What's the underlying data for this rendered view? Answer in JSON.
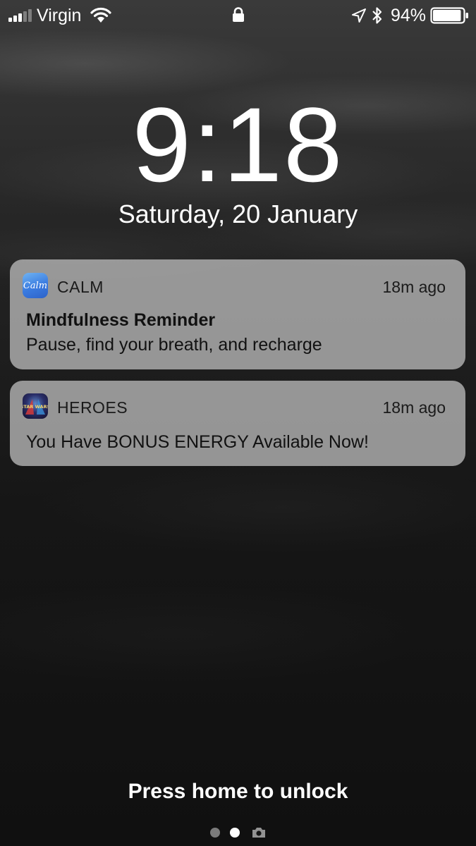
{
  "status_bar": {
    "carrier": "Virgin",
    "battery_percent": "94%",
    "signal_bars_filled": 3,
    "signal_bars_total": 5,
    "battery_level": 0.94,
    "icons": [
      "signal-icon",
      "wifi-icon",
      "lock-icon",
      "location-icon",
      "bluetooth-icon",
      "battery-icon"
    ]
  },
  "lock_screen": {
    "time": "9:18",
    "date": "Saturday, 20 January",
    "unlock_hint": "Press home to unlock"
  },
  "notifications": [
    {
      "app": "CALM",
      "icon": "calm-app-icon",
      "icon_text": "Calm",
      "time": "18m ago",
      "title": "Mindfulness Reminder",
      "body": "Pause, find your breath, and recharge"
    },
    {
      "app": "HEROES",
      "icon": "star-wars-heroes-app-icon",
      "icon_text": "STAR WARS",
      "time": "18m ago",
      "title": "",
      "body": "You Have BONUS ENERGY Available Now!"
    }
  ],
  "page_indicator": {
    "pages": 2,
    "active_index": 1,
    "trailing_icon": "camera-icon"
  },
  "colors": {
    "notification_background": "#b9b9b9",
    "text_primary": "#ffffff",
    "notification_text": "#111111",
    "calm_brand": "#3a7be0"
  }
}
